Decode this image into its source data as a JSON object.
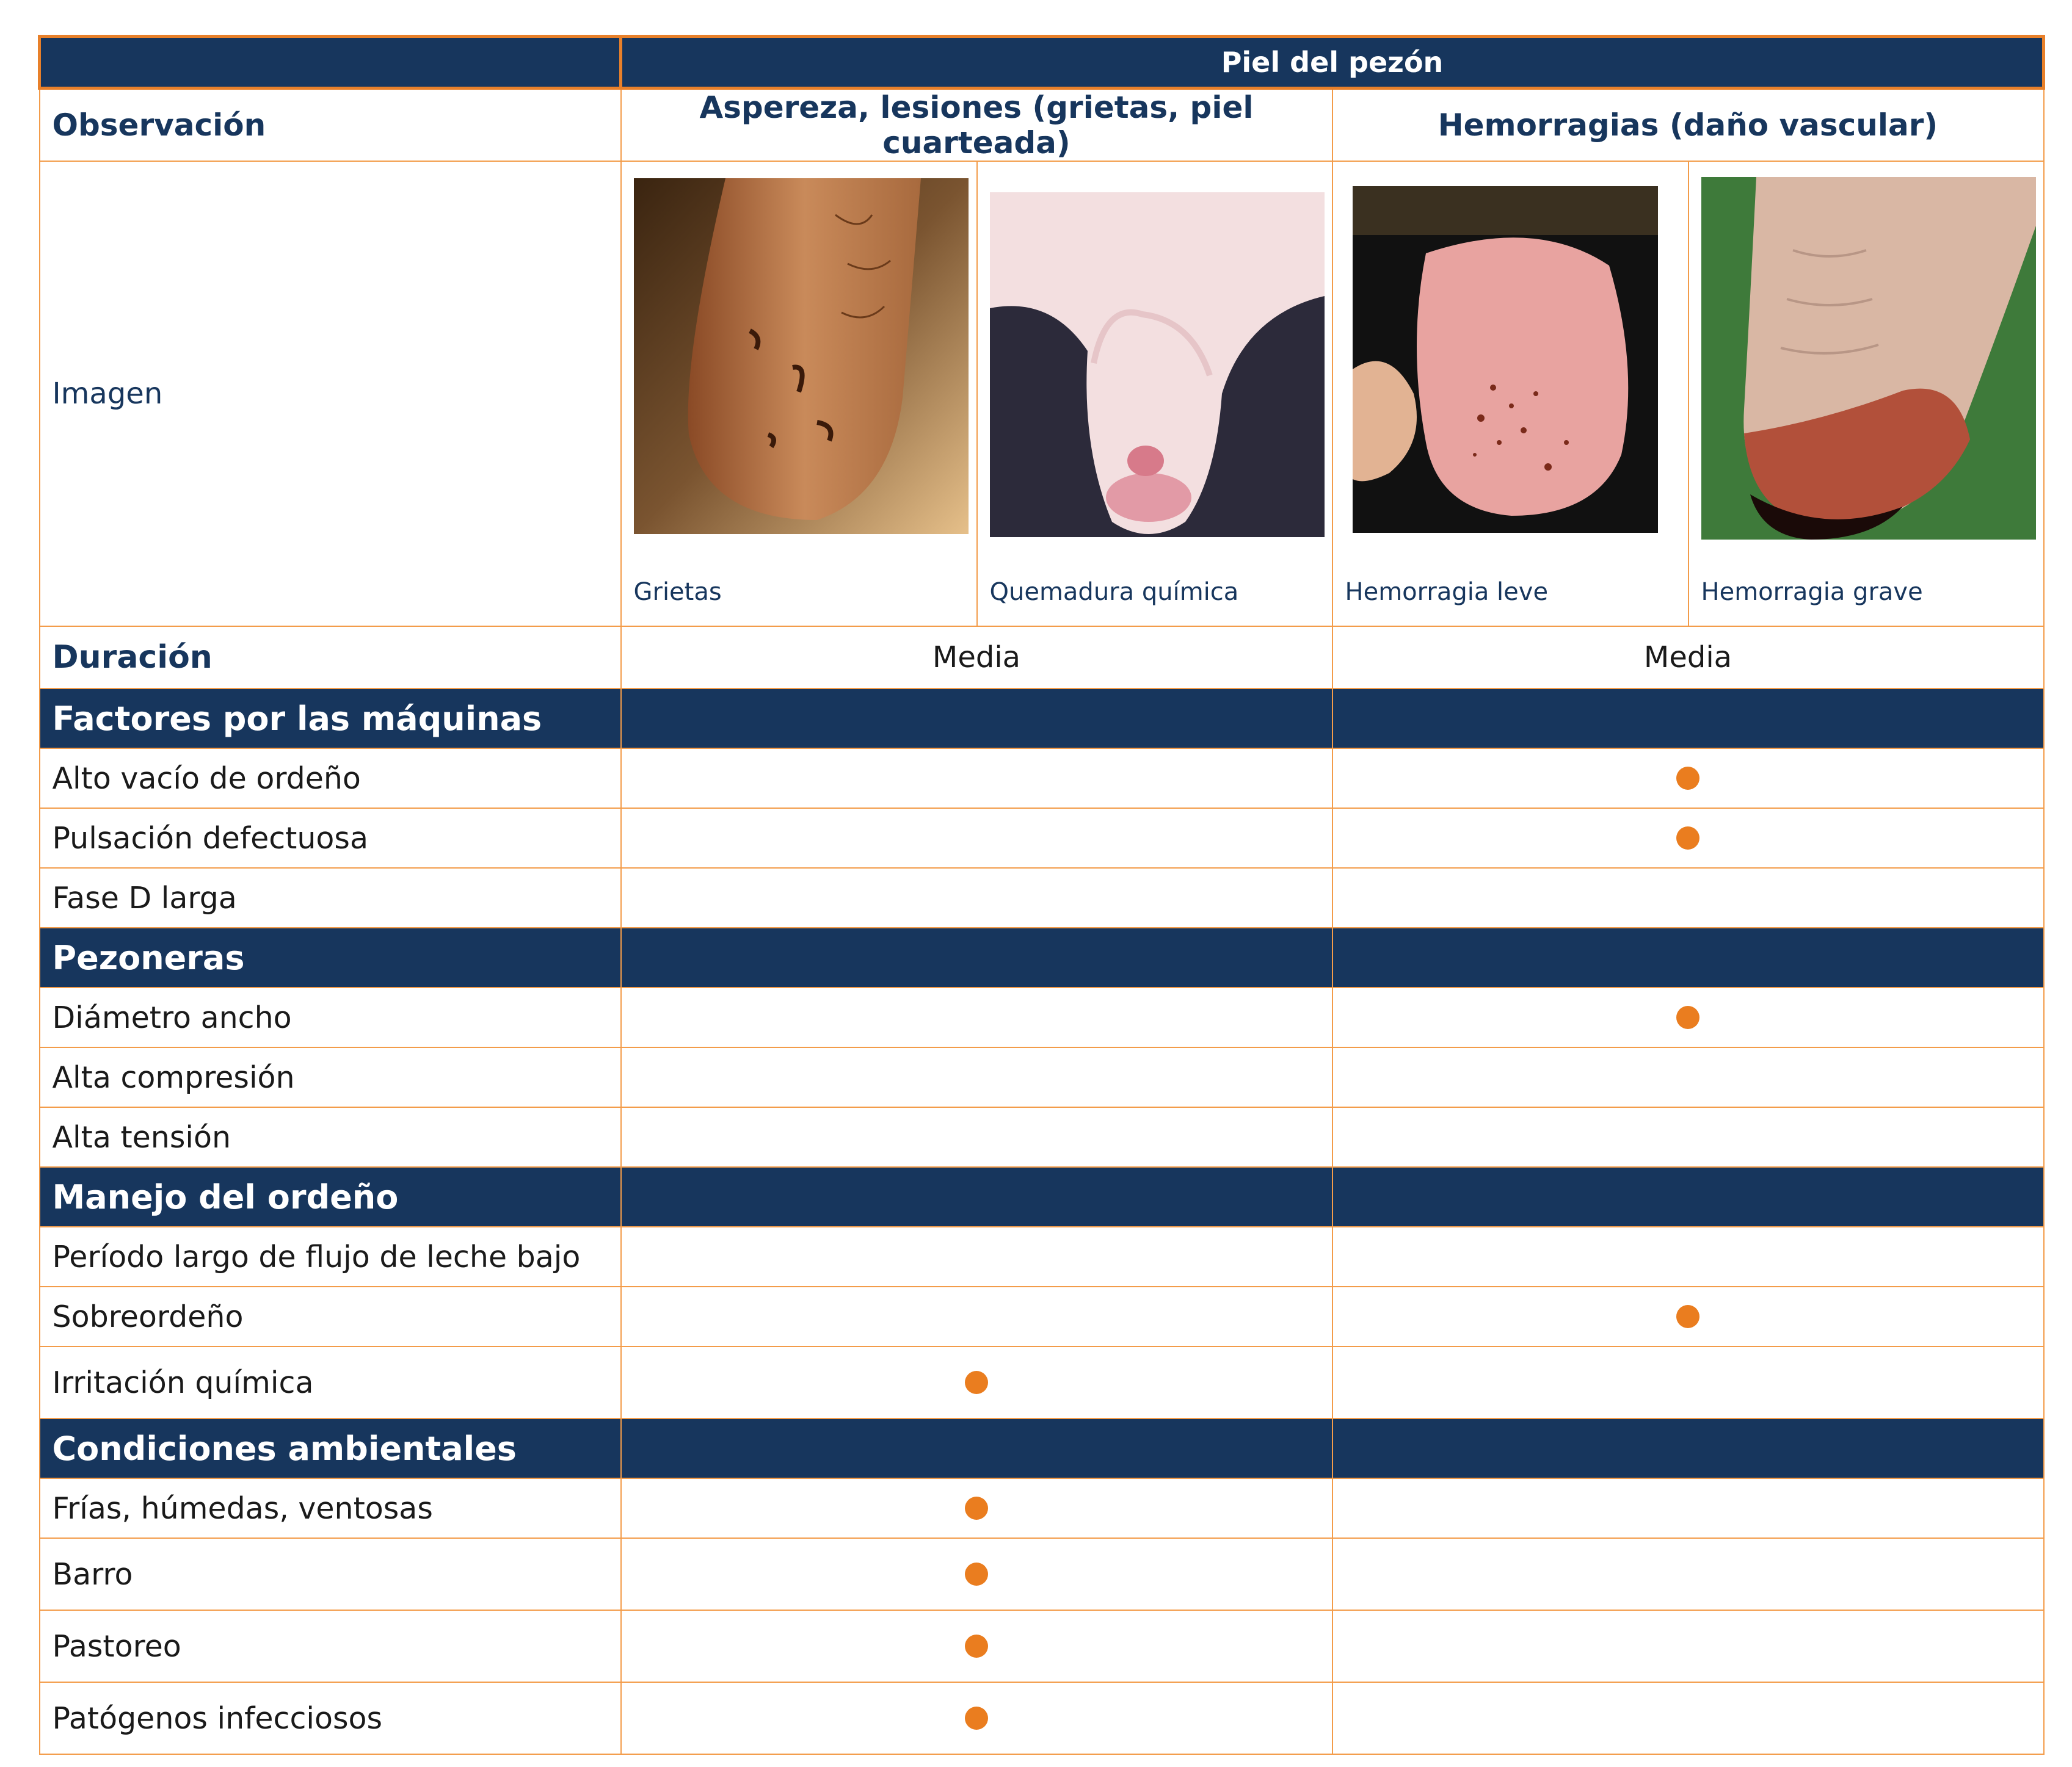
{
  "table": {
    "top_header": "Piel del pezón",
    "col_observation": "Observación",
    "col_group1": "Aspereza, lesiones (grietas, piel cuarteada)",
    "col_group2": "Hemorragias (daño vascular)",
    "image_row_label": "Imagen",
    "images": [
      {
        "caption": "Grietas",
        "description": "teat-with-cracks"
      },
      {
        "caption": "Quemadura química",
        "description": "teat-chemical-burn"
      },
      {
        "caption": "Hemorragia leve",
        "description": "teat-mild-hemorrhage"
      },
      {
        "caption": "Hemorragia grave",
        "description": "teat-severe-hemorrhage"
      }
    ],
    "duration_label": "Duración",
    "duration_values": [
      "Media",
      "Media"
    ]
  },
  "sections": [
    {
      "title": "Factores por las máquinas",
      "items": [
        {
          "label": "Alto vacío de ordeño",
          "group1": false,
          "group2": true
        },
        {
          "label": "Pulsación defectuosa",
          "group1": false,
          "group2": true
        },
        {
          "label": "Fase D larga",
          "group1": false,
          "group2": false
        }
      ]
    },
    {
      "title": "Pezoneras",
      "items": [
        {
          "label": "Diámetro ancho",
          "group1": false,
          "group2": true
        },
        {
          "label": "Alta compresión",
          "group1": false,
          "group2": false
        },
        {
          "label": "Alta tensión",
          "group1": false,
          "group2": false
        }
      ]
    },
    {
      "title": "Manejo del ordeño",
      "items": [
        {
          "label": "Período largo de flujo de leche bajo",
          "group1": false,
          "group2": false
        },
        {
          "label": "Sobreordeño",
          "group1": false,
          "group2": true
        },
        {
          "label": "Irritación química",
          "group1": true,
          "group2": false
        }
      ]
    },
    {
      "title": "Condiciones ambientales",
      "items": [
        {
          "label": "Frías, húmedas, ventosas",
          "group1": true,
          "group2": false
        },
        {
          "label": "Barro",
          "group1": true,
          "group2": false
        },
        {
          "label": "Pastoreo",
          "group1": true,
          "group2": false
        },
        {
          "label": "Patógenos infecciosos",
          "group1": true,
          "group2": false
        }
      ]
    }
  ],
  "colors": {
    "navy": "#17365d",
    "orange_border": "#f39c4a",
    "dot": "#ea7d1f"
  }
}
